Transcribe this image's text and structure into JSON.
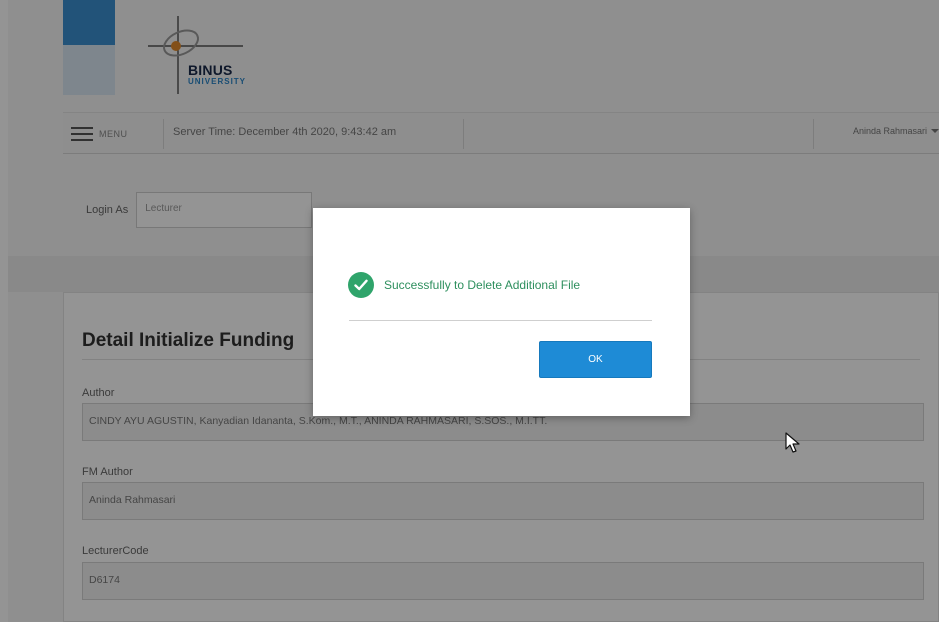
{
  "header": {
    "logo_brand": "BINUS",
    "logo_sub": "UNIVERSITY"
  },
  "nav": {
    "menu_label": "MENU",
    "server_time": "Server Time: December 4th 2020, 9:43:42 am",
    "user_name": "Aninda Rahmasari"
  },
  "login": {
    "label": "Login As",
    "value": "Lecturer"
  },
  "detail": {
    "title": "Detail Initialize Funding",
    "fields": [
      {
        "label": "Author",
        "value": "CINDY AYU AGUSTIN, Kanyadian Idananta, S.Kom., M.T., ANINDA RAHMASARI, S.SOS., M.I.TT."
      },
      {
        "label": "FM Author",
        "value": "Aninda Rahmasari"
      },
      {
        "label": "LecturerCode",
        "value": "D6174"
      }
    ]
  },
  "modal": {
    "icon": "check-circle-icon",
    "message": "Successfully to Delete Additional File",
    "ok_label": "OK"
  },
  "colors": {
    "accent_blue": "#1e8bd6",
    "success_green": "#2fa46b",
    "brand_blue": "#3c8fd0"
  }
}
